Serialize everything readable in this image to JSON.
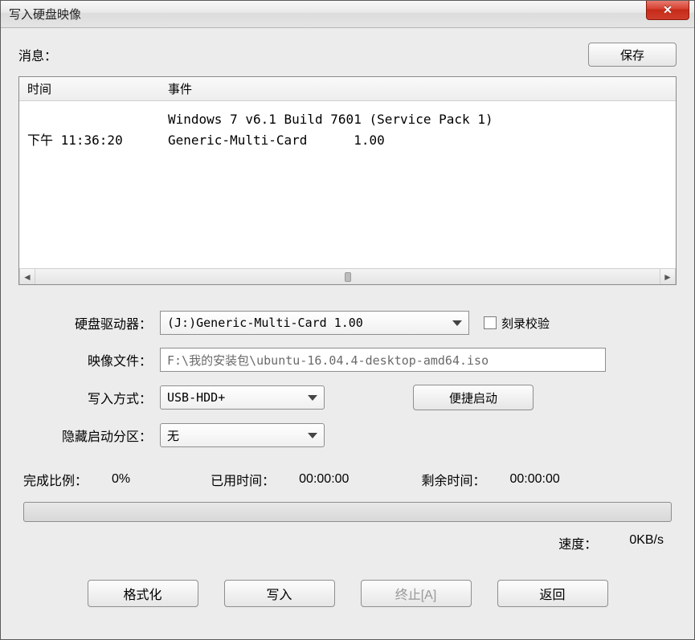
{
  "window": {
    "title": "写入硬盘映像"
  },
  "msg": {
    "label": "消息：",
    "save_btn": "保存"
  },
  "log": {
    "col_time": "时间",
    "col_event": "事件",
    "rows": [
      {
        "time": "",
        "event": "Windows 7 v6.1 Build 7601 (Service Pack 1)"
      },
      {
        "time": "下午 11:36:20",
        "event": "Generic-Multi-Card      1.00"
      }
    ]
  },
  "fields": {
    "drive": {
      "label": "硬盘驱动器：",
      "value": "(J:)Generic-Multi-Card      1.00"
    },
    "verify": {
      "label": "刻录校验"
    },
    "image": {
      "label": "映像文件：",
      "value": "F:\\我的安装包\\ubuntu-16.04.4-desktop-amd64.iso"
    },
    "write_mode": {
      "label": "写入方式：",
      "value": "USB-HDD+"
    },
    "quick_boot_btn": "便捷启动",
    "hide_boot": {
      "label": "隐藏启动分区：",
      "value": "无"
    }
  },
  "progress": {
    "percent_label": "完成比例：",
    "percent_value": "0%",
    "elapsed_label": "已用时间：",
    "elapsed_value": "00:00:00",
    "remain_label": "剩余时间：",
    "remain_value": "00:00:00",
    "speed_label": "速度：",
    "speed_value": "0KB/s"
  },
  "buttons": {
    "format": "格式化",
    "write": "写入",
    "abort": "终止[A]",
    "back": "返回"
  }
}
